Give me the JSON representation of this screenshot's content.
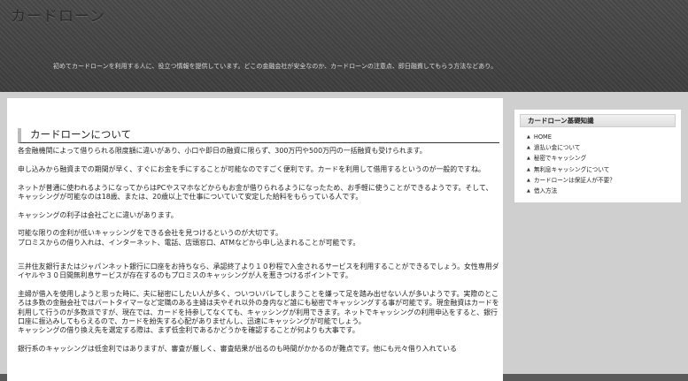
{
  "header": {
    "site_title": "カードローン",
    "tagline": "初めてカードローンを利用する人に、役立つ情報を提供しています。どこの金融会社が安全なのか、カードローンの注意点、即日融資してもらう方法などあり。"
  },
  "main": {
    "heading": "カードローンについて",
    "paragraphs": [
      "各金融機関によって借りられる限度額に違いがあり、小口や即日の融資に限らず、300万円や500万円の一括融資も受けられます。",
      "申し込みから融資までの期間が早く、すぐにお金を手にすることが可能なのですごく便利です。カードを利用して借用するというのが一般的ですね。",
      "ネットが普通に使われるようになってからはPCやスマホなどからもお金が借りられるようになったため、お手軽に使うことができるようです。そして、キャッシングが可能なのは18歳、または、20歳以上で仕事についていて安定した給料をもらっている人です。",
      "キャッシングの利子は会社ごとに違いがあります。",
      "可能な限りの金利が低いキャッシングをできる会社を見つけるというのが大切です。\nプロミスからの借り入れは、インターネット、電話、店頭窓口、ATMなどから申し込まれることが可能です。",
      "三井住友銀行またはジャパンネット銀行に口座をお持ちなら、承認終了より１０秒程で入金されるサービスを利用することができるでしょう。女性専用ダイヤルや３０日間無利息サービスが存在するのもプロミスのキャッシングが人を惹きつけるポイントです。",
      "主婦が借入を使用しようと思った時に、夫に秘密にしたい人が多く、ついついバレてしまうことを嫌って足を踏み出せない人が多いようです。実際のところは多数の金融会社ではパートタイマーなど定職のある主婦は夫やそれ以外の身内など誰にも秘密でキャッシングする事が可能です。現金融資はカードを利用して行うのが多数派ですが、現在では、カードを持参してなくても、キャッシングが利用できます。ネットでキャッシングの利用申込をすると、銀行口座に振込みしてもらえるので、カードを紛失する心配がありませんし、迅速にキャッシングが可能でしょう。\nキャッシングの借り換え先を選定する際は、まず低金利であるかどうかを確認することが何よりも大事です。",
      "銀行系のキャッシングは低金利ではありますが、審査が厳しく、審査結果が出るのも時間がかかるのが難点です。他にも元々借り入れている"
    ]
  },
  "sidebar": {
    "heading": "カードローン基礎知識",
    "bullet_glyph": "▲",
    "items": [
      "HOME",
      "過払い金について",
      "秘密でキャッシング",
      "無利息キャッシングについて",
      "カードローンは保証人が不要？",
      "借入方法"
    ]
  }
}
